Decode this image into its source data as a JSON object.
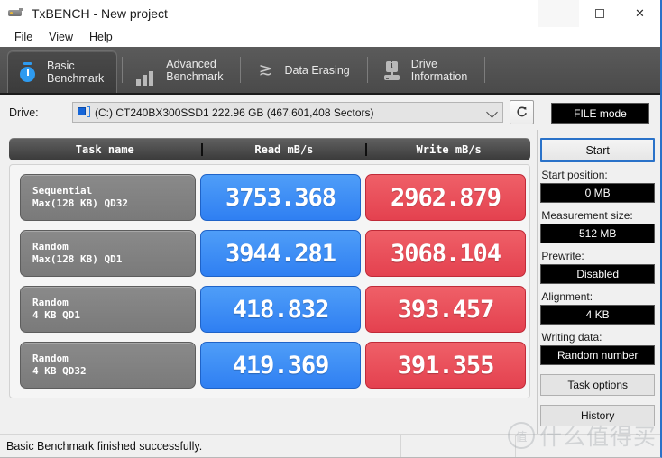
{
  "window": {
    "title": "TxBENCH - New project",
    "icon": "drive-icon",
    "controls": {
      "minimize": "—",
      "maximize": "□",
      "close": "✕"
    }
  },
  "menubar": {
    "items": [
      "File",
      "View",
      "Help"
    ]
  },
  "tabs": [
    {
      "id": "basic-benchmark",
      "line1": "Basic",
      "line2": "Benchmark",
      "icon": "stopwatch-icon",
      "active": true
    },
    {
      "id": "advanced-benchmark",
      "line1": "Advanced",
      "line2": "Benchmark",
      "icon": "bar-chart-icon",
      "active": false
    },
    {
      "id": "data-erasing",
      "line1": "Data Erasing",
      "line2": "",
      "icon": "wave-icon",
      "active": false
    },
    {
      "id": "drive-information",
      "line1": "Drive",
      "line2": "Information",
      "icon": "drive-info-icon",
      "active": false
    }
  ],
  "drivebar": {
    "label": "Drive:",
    "selected": "(C:) CT240BX300SSD1  222.96 GB (467,601,408 Sectors)",
    "refresh_icon": "refresh-icon",
    "dropdown_icon": "chevron-down-icon"
  },
  "mode_button": {
    "label": "FILE mode"
  },
  "table": {
    "headers": [
      "Task name",
      "Read mB/s",
      "Write mB/s"
    ],
    "rows": [
      {
        "name_line1": "Sequential",
        "name_line2": "Max(128 KB) QD32",
        "read": "3753.368",
        "write": "2962.879"
      },
      {
        "name_line1": "Random",
        "name_line2": "Max(128 KB) QD1",
        "read": "3944.281",
        "write": "3068.104"
      },
      {
        "name_line1": "Random",
        "name_line2": "4 KB QD1",
        "read": "418.832",
        "write": "393.457"
      },
      {
        "name_line1": "Random",
        "name_line2": "4 KB QD32",
        "read": "419.369",
        "write": "391.355"
      }
    ]
  },
  "sidebar": {
    "start_button": "Start",
    "fields": [
      {
        "label": "Start position:",
        "value": "0 MB"
      },
      {
        "label": "Measurement size:",
        "value": "512 MB"
      },
      {
        "label": "Prewrite:",
        "value": "Disabled"
      },
      {
        "label": "Alignment:",
        "value": "4 KB"
      },
      {
        "label": "Writing data:",
        "value": "Random number"
      }
    ],
    "buttons": [
      "Task options",
      "History"
    ]
  },
  "statusbar": {
    "message": "Basic Benchmark finished successfully."
  },
  "watermark": {
    "mark": "值",
    "text": "什么值得买"
  },
  "colors": {
    "read": "#3f8ef5",
    "write": "#e8505c",
    "accent": "#2a72c9",
    "tabstrip": "#4f4f4f"
  }
}
